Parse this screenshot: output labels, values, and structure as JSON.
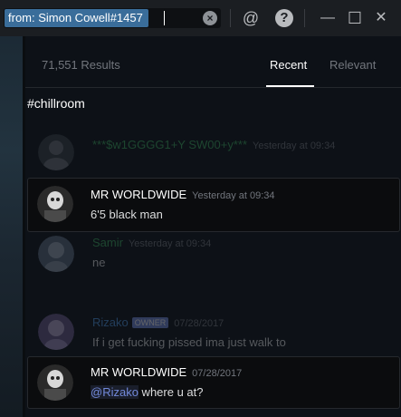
{
  "search": {
    "query": "from: Simon Cowell#1457",
    "clear_icon": "close-circle-icon"
  },
  "toolbar": {
    "mention_label": "@",
    "help_label": "?",
    "minimize_label": "—",
    "maximize_label": "☐",
    "close_label": "✕"
  },
  "results": {
    "count": "71,551 Results",
    "tabs": [
      {
        "label": "Recent",
        "active": true
      },
      {
        "label": "Relevant",
        "active": false
      }
    ]
  },
  "channel": "#chillroom",
  "messages": [
    {
      "author": "***$w1GGGG1+Y SW00+y***",
      "author_color": "#3ba55c",
      "timestamp": "Yesterday at 09:34",
      "content": "",
      "style": "dim"
    },
    {
      "author": "MR WORLDWIDE",
      "author_color": "#ffffff",
      "timestamp": "Yesterday at 09:34",
      "content": "6'5 black man",
      "style": "card"
    },
    {
      "author": "Samir",
      "author_color": "#3ba55c",
      "timestamp": "Yesterday at 09:34",
      "content": "ne",
      "style": "dim"
    },
    {
      "author": "Rizako",
      "author_color": "#4a90d9",
      "badge": "OWNER",
      "timestamp": "07/28/2017",
      "content": "If i get fucking pissed ima just walk to",
      "style": "dim"
    },
    {
      "author": "MR WORLDWIDE",
      "author_color": "#ffffff",
      "timestamp": "07/28/2017",
      "mention": "@Rizako",
      "content": " where u at?",
      "style": "card"
    }
  ]
}
